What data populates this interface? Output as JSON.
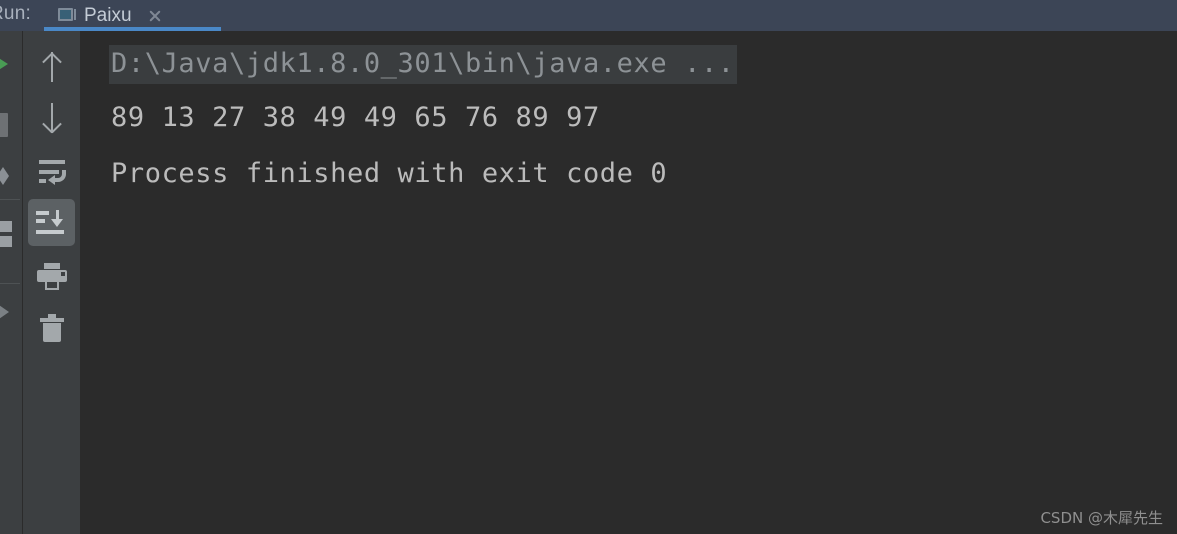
{
  "window": {
    "header_label": "Run:",
    "theme_colors": {
      "header_bg": "#3c4556",
      "toolbar_bg": "#3c3f41",
      "console_bg": "#2b2b2b",
      "tab_accent": "#4a88c7",
      "active_button_bg": "#5c6164",
      "text": "#a9b7c6",
      "run_green": "#499c54"
    }
  },
  "tab": {
    "label": "Paixu",
    "icon": "console-monitor-icon",
    "close_icon": "close-icon",
    "active": true
  },
  "left_gutter": {
    "items": [
      {
        "name": "run-button",
        "icon": "play-icon"
      },
      {
        "name": "stop-button",
        "icon": "stop-square-icon"
      },
      {
        "name": "rerun-button",
        "icon": "rerun-icon"
      },
      {
        "name": "layout-button",
        "icon": "layout-icon"
      },
      {
        "name": "resume-button",
        "icon": "resume-arrow-icon"
      }
    ]
  },
  "toolbar": {
    "items": [
      {
        "name": "up-the-stack-trace-button",
        "icon": "arrow-up-icon",
        "active": false
      },
      {
        "name": "down-the-stack-trace-button",
        "icon": "arrow-down-icon",
        "active": false
      },
      {
        "name": "soft-wrap-button",
        "icon": "soft-wrap-icon",
        "active": false
      },
      {
        "name": "scroll-to-end-button",
        "icon": "scroll-to-end-icon",
        "active": true
      },
      {
        "name": "print-button",
        "icon": "print-icon",
        "active": false
      },
      {
        "name": "clear-all-button",
        "icon": "trash-icon",
        "active": false
      }
    ]
  },
  "console": {
    "command_line": "D:\\Java\\jdk1.8.0_301\\bin\\java.exe ...",
    "output_numbers": "89 13 27 38 49 49 65 76 89 97",
    "exit_message": "Process finished with exit code 0",
    "sorted_values": [
      89,
      13,
      27,
      38,
      49,
      49,
      65,
      76,
      89,
      97
    ]
  },
  "watermark": {
    "text": "CSDN @木犀先生"
  }
}
